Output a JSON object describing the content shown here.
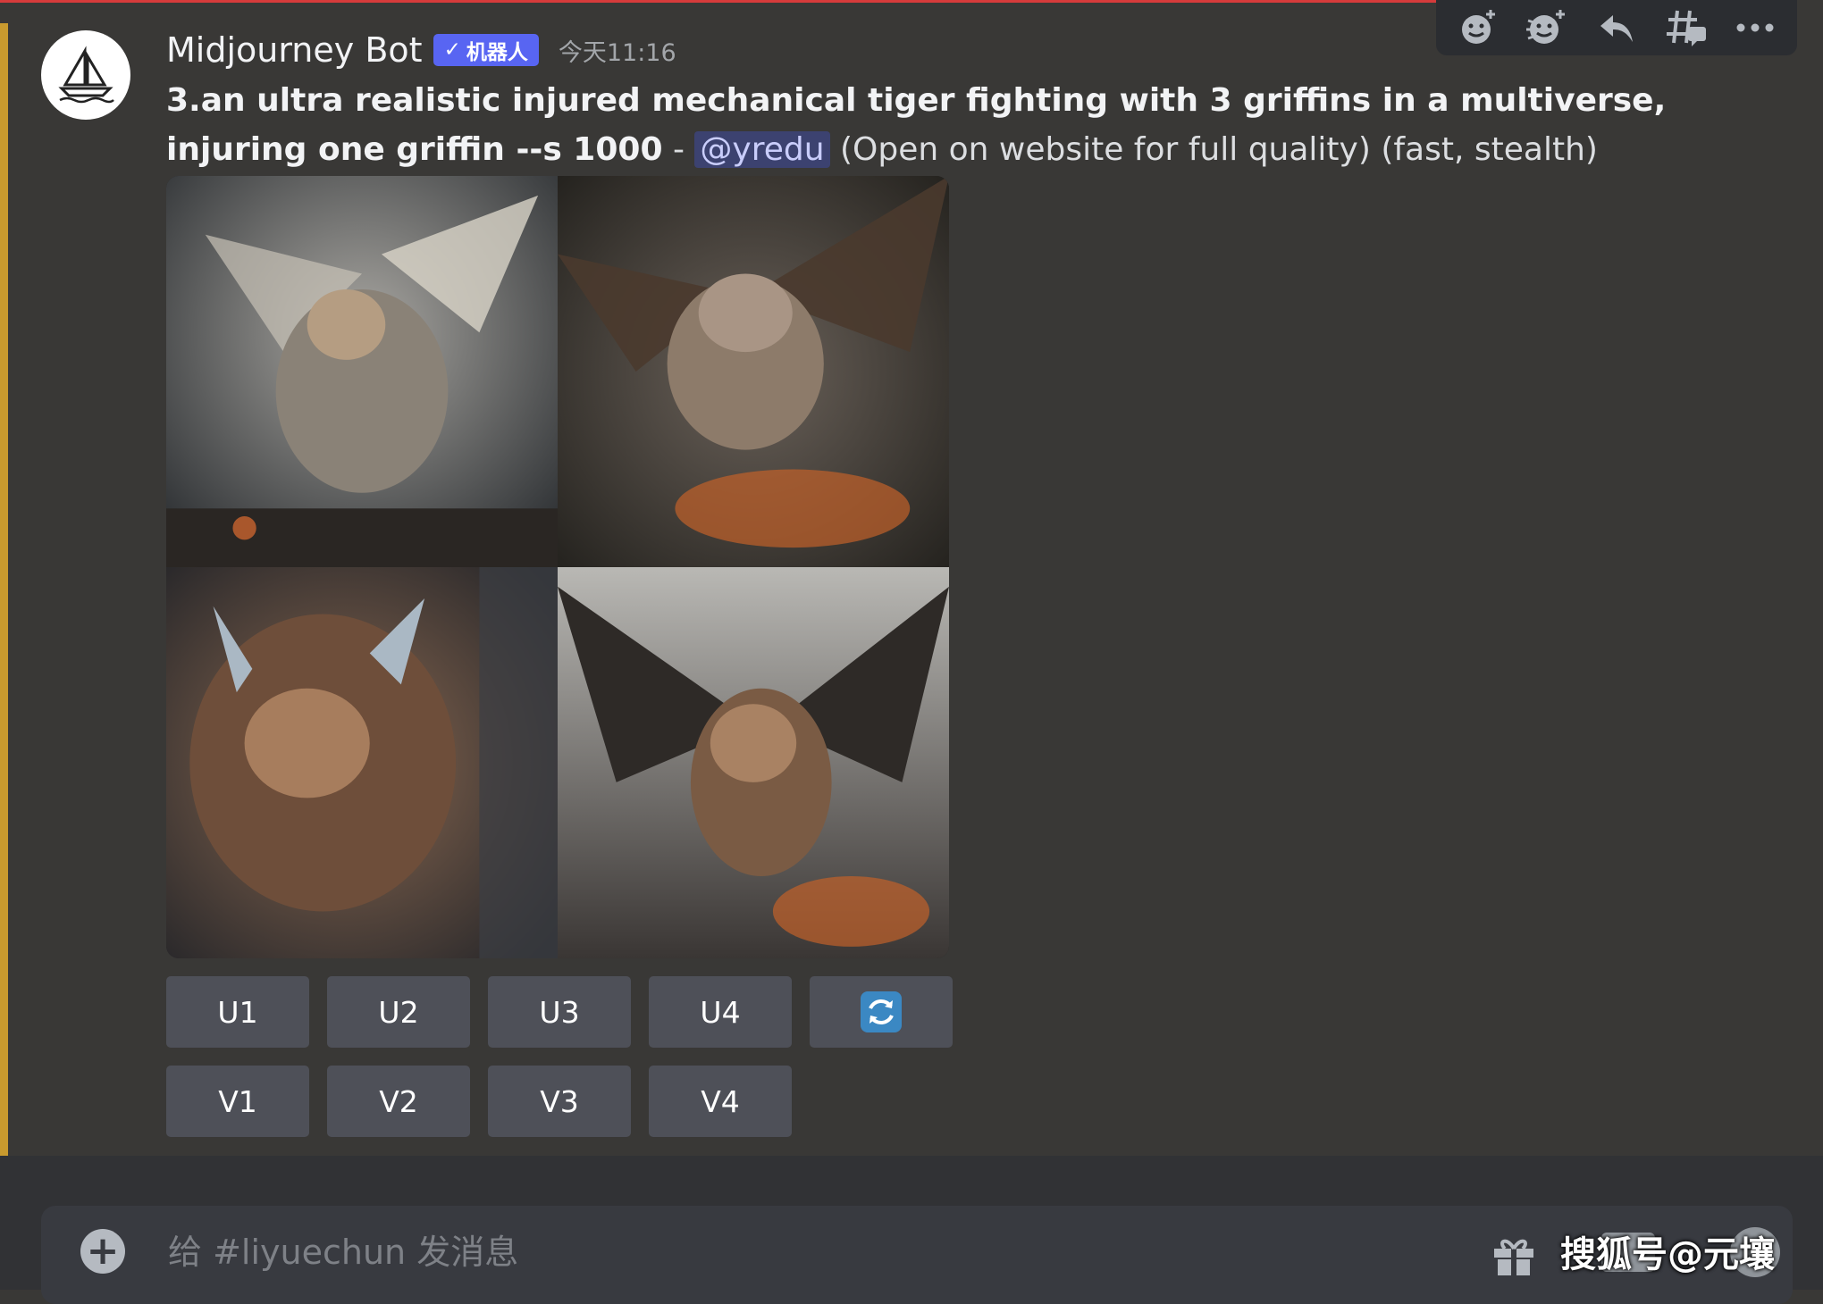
{
  "message": {
    "username": "Midjourney Bot",
    "badge": "机器人",
    "badge_check": "✓",
    "timestamp": "今天11:16",
    "prompt_bold": "3.an ultra realistic injured mechanical tiger fighting with 3 griffins in a multiverse, injuring one griffin --s 1000",
    "prompt_sep": " - ",
    "mention": "@yredu",
    "prompt_tail": " (Open on website for full quality) (fast, stealth)"
  },
  "images": [
    {
      "name": "image-1",
      "palette": [
        "#3c3f42",
        "#7a7b78",
        "#c9c5bd"
      ]
    },
    {
      "name": "image-2",
      "palette": [
        "#2f2a26",
        "#6f5c4b",
        "#c98a54"
      ]
    },
    {
      "name": "image-3",
      "palette": [
        "#2a2c30",
        "#6b5242",
        "#b88662"
      ]
    },
    {
      "name": "image-4",
      "palette": [
        "#43454a",
        "#7c6656",
        "#c28c5d"
      ]
    }
  ],
  "buttons": {
    "upscale": [
      "U1",
      "U2",
      "U3",
      "U4"
    ],
    "variation": [
      "V1",
      "V2",
      "V3",
      "V4"
    ],
    "reroll_icon": "refresh-icon"
  },
  "toolbar": {
    "icons": [
      "add-reaction-icon",
      "super-reaction-icon",
      "reply-icon",
      "create-thread-icon",
      "more-icon"
    ]
  },
  "composer": {
    "placeholder": "给 #liyuechun 发消息",
    "value": ""
  },
  "watermark": "搜狐号@元壤",
  "colors": {
    "background": "#393836",
    "blurple": "#5865f2",
    "button": "#4e5058",
    "mention_bar": "#c99a2e"
  }
}
